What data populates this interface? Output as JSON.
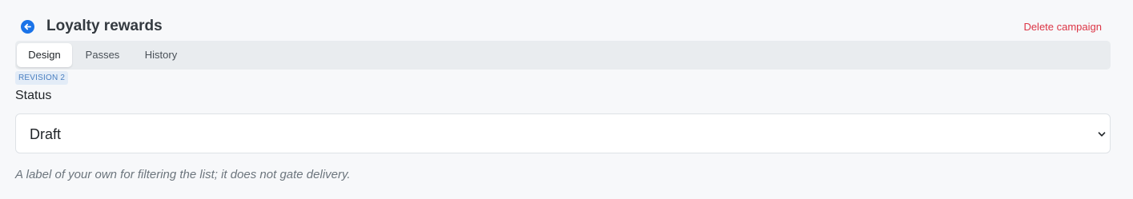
{
  "header": {
    "title": "Loyalty rewards",
    "back_icon": "arrow-left-circle-icon",
    "delete_label": "Delete campaign"
  },
  "tabs": [
    {
      "label": "Design",
      "active": true
    },
    {
      "label": "Passes",
      "active": false
    },
    {
      "label": "History",
      "active": false
    }
  ],
  "revision_badge": "REVISION 2",
  "status": {
    "label": "Status",
    "selected": "Draft",
    "help": "A label of your own for filtering the list; it does not gate delivery."
  },
  "colors": {
    "accent": "#1a73e8",
    "danger": "#dc3545",
    "badge_text": "#4a7fc1",
    "badge_bg": "#e3ecf7"
  }
}
